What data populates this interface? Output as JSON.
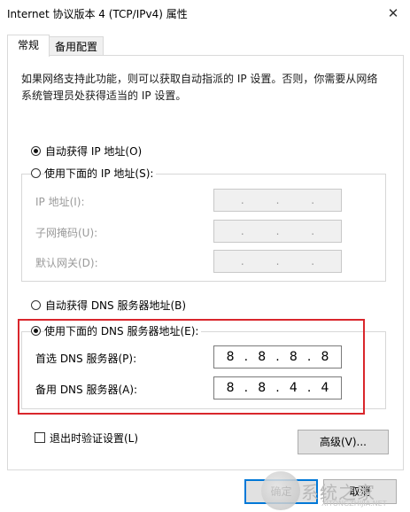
{
  "window": {
    "title": "Internet 协议版本 4 (TCP/IPv4) 属性",
    "close_glyph": "✕"
  },
  "tabs": [
    {
      "label": "常规",
      "active": true
    },
    {
      "label": "备用配置",
      "active": false
    }
  ],
  "description": "如果网络支持此功能，则可以获取自动指派的 IP 设置。否则，你需要从网络系统管理员处获得适当的 IP 设置。",
  "ip": {
    "auto_label": "自动获得 IP 地址(O)",
    "manual_label": "使用下面的 IP 地址(S):",
    "mode": "auto",
    "fields": [
      {
        "label": "IP 地址(I):",
        "octets": [
          "",
          "",
          "",
          ""
        ]
      },
      {
        "label": "子网掩码(U):",
        "octets": [
          "",
          "",
          "",
          ""
        ]
      },
      {
        "label": "默认网关(D):",
        "octets": [
          "",
          "",
          "",
          ""
        ]
      }
    ]
  },
  "dns": {
    "auto_label": "自动获得 DNS 服务器地址(B)",
    "manual_label": "使用下面的 DNS 服务器地址(E):",
    "mode": "manual",
    "preferred": {
      "label": "首选 DNS 服务器(P):",
      "octets": [
        "8",
        "8",
        "8",
        "8"
      ]
    },
    "alternate": {
      "label": "备用 DNS 服务器(A):",
      "octets": [
        "8",
        "8",
        "4",
        "4"
      ]
    }
  },
  "validate_on_exit": {
    "label": "退出时验证设置(L)",
    "checked": false
  },
  "buttons": {
    "advanced": "高级(V)...",
    "ok": "确定",
    "cancel": "取消"
  },
  "watermark": {
    "text": "系统之家",
    "sub": "XITONGZHIJIA.NET"
  },
  "colors": {
    "highlight": "#d9262c",
    "primary_border": "#0078d7"
  },
  "icons": {
    "close": "close-icon",
    "radio": "radio-icon",
    "checkbox": "checkbox-icon"
  }
}
